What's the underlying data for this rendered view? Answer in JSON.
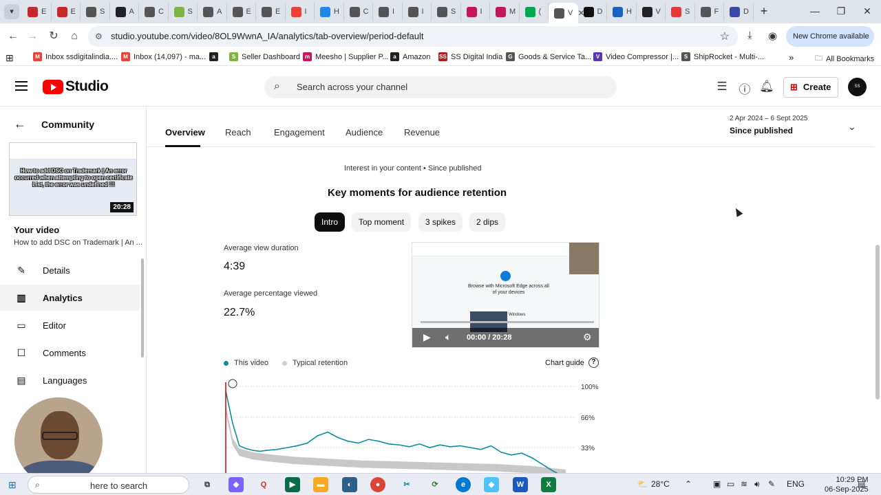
{
  "browser": {
    "tabs": [
      {
        "label": "E",
        "fav_color": "#c62828"
      },
      {
        "label": "E",
        "fav_color": "#c62828"
      },
      {
        "label": "S",
        "fav_color": "#555555"
      },
      {
        "label": "A",
        "fav_color": "#222222"
      },
      {
        "label": "C",
        "fav_color": "#555555"
      },
      {
        "label": "S",
        "fav_color": "#7cb342"
      },
      {
        "label": "A",
        "fav_color": "#555555"
      },
      {
        "label": "E",
        "fav_color": "#555555"
      },
      {
        "label": "E",
        "fav_color": "#555555"
      },
      {
        "label": "I",
        "fav_color": "#ea4335"
      },
      {
        "label": "H",
        "fav_color": "#1e88e5"
      },
      {
        "label": "C",
        "fav_color": "#555555"
      },
      {
        "label": "I",
        "fav_color": "#555555"
      },
      {
        "label": "I",
        "fav_color": "#555555"
      },
      {
        "label": "S",
        "fav_color": "#555555"
      },
      {
        "label": "I",
        "fav_color": "#c2185b"
      },
      {
        "label": "M",
        "fav_color": "#c2185b"
      },
      {
        "label": "(",
        "fav_color": "#00a84f"
      },
      {
        "label": "V",
        "fav_color": "#555555"
      },
      {
        "label": "D",
        "fav_color": "#111111"
      },
      {
        "label": "H",
        "fav_color": "#1565c0"
      },
      {
        "label": "V",
        "fav_color": "#222222"
      },
      {
        "label": "S",
        "fav_color": "#e53935"
      },
      {
        "label": "F",
        "fav_color": "#555555"
      },
      {
        "label": "D",
        "fav_color": "#3949ab"
      }
    ],
    "url": "studio.youtube.com/video/8OL9WwnA_IA/analytics/tab-overview/period-default",
    "new_chrome_label": "New Chrome available",
    "bookmarks": [
      {
        "label": "Inbox ssdigitalindia....",
        "color": "#ea4335",
        "icon": "M"
      },
      {
        "label": "Inbox (14,097) - ma...",
        "color": "#ea4335",
        "icon": "M"
      },
      {
        "label": "",
        "color": "#222222",
        "icon": "a"
      },
      {
        "label": "Seller Dashboard",
        "color": "#7cb342",
        "icon": "S"
      },
      {
        "label": "Meesho | Supplier P...",
        "color": "#c2185b",
        "icon": "m"
      },
      {
        "label": "Amazon",
        "color": "#222222",
        "icon": "a"
      },
      {
        "label": "SS Digital India",
        "color": "#b71c1c",
        "icon": "SS"
      },
      {
        "label": "Goods & Service Ta...",
        "color": "#555555",
        "icon": "G"
      },
      {
        "label": "Video Compressor |...",
        "color": "#5e35b1",
        "icon": "V"
      },
      {
        "label": "ShipRocket - Multi-...",
        "color": "#555555",
        "icon": "S"
      }
    ],
    "all_bookmarks": "All Bookmarks"
  },
  "header": {
    "logo_text": "Studio",
    "search_placeholder": "Search across your channel",
    "create_label": "Create",
    "avatar_text": "SS"
  },
  "sidebar": {
    "back_label": "Community",
    "thumb_title": "How to add DSC on Trademark | An error occurred when attempting to open certificate List, the error was undefined !!!",
    "thumb_duration": "20:28",
    "your_video": "Your video",
    "video_title": "How to add DSC on Trademark | An ...",
    "items": [
      {
        "label": "Details",
        "icon": "pencil-icon"
      },
      {
        "label": "Analytics",
        "icon": "analytics-icon"
      },
      {
        "label": "Editor",
        "icon": "editor-icon"
      },
      {
        "label": "Comments",
        "icon": "comments-icon"
      },
      {
        "label": "Languages",
        "icon": "languages-icon"
      }
    ]
  },
  "main": {
    "tabs": [
      "Overview",
      "Reach",
      "Engagement",
      "Audience",
      "Revenue"
    ],
    "date_range": "2 Apr 2024 – 6 Sept 2025",
    "date_label": "Since published",
    "subtitle": "Interest in your content • Since published",
    "section_title": "Key moments for audience retention",
    "chips": [
      "Intro",
      "Top moment",
      "3 spikes",
      "2 dips"
    ],
    "avg_view_duration_label": "Average view duration",
    "avg_view_duration": "4:39",
    "avg_pct_label": "Average percentage viewed",
    "avg_pct": "22.7%",
    "player_time": "00:00 / 20:28",
    "player_edge_text": "Browse with Microsoft Edge across all of your devices",
    "player_windows_text": "Windows",
    "legend_this": "This video",
    "legend_typical": "Typical retention",
    "chart_guide": "Chart guide"
  },
  "chart_data": {
    "type": "line",
    "y_ticks": [
      "100%",
      "66%",
      "33%"
    ],
    "series": [
      {
        "name": "This video",
        "color": "#0f8a9d",
        "x": [
          0,
          2,
          4,
          6,
          8,
          10,
          12,
          15,
          18,
          21,
          24,
          27,
          30,
          33,
          36,
          39,
          42,
          45,
          48,
          51,
          54,
          57,
          60,
          63,
          66,
          69,
          72,
          75,
          78,
          81,
          84,
          87,
          90,
          93,
          96,
          100
        ],
        "y": [
          95,
          60,
          35,
          32,
          30,
          29,
          30,
          31,
          33,
          35,
          38,
          46,
          50,
          44,
          40,
          38,
          42,
          40,
          37,
          36,
          34,
          37,
          33,
          36,
          34,
          35,
          33,
          31,
          35,
          28,
          25,
          27,
          22,
          15,
          8,
          0
        ]
      },
      {
        "name": "Typical retention",
        "color": "#c8c8c8",
        "x": [
          0,
          2,
          4,
          8,
          12,
          20,
          30,
          40,
          50,
          60,
          70,
          80,
          90,
          100
        ],
        "y": [
          75,
          40,
          28,
          24,
          22,
          19,
          17,
          15,
          14,
          13,
          12,
          11,
          9,
          5
        ]
      }
    ],
    "ylim": [
      0,
      100
    ]
  },
  "taskbar": {
    "search_text": "here to search",
    "weather": "28°C",
    "lang": "ENG",
    "time": "10:29 PM",
    "date": "06-Sep-2025"
  }
}
